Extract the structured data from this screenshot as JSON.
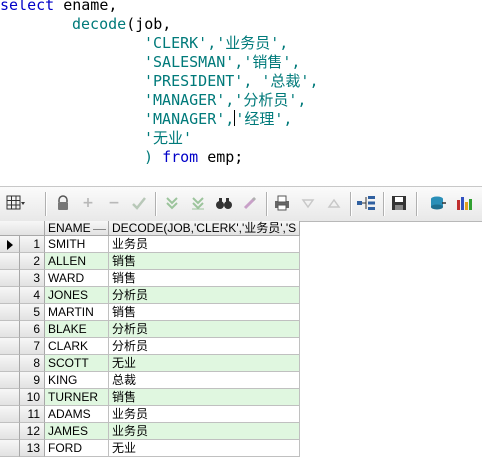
{
  "sql": {
    "line1": {
      "kw": "select",
      "rest": " ename,"
    },
    "line2": {
      "fn": "decode",
      "rest": "(job,"
    },
    "line3": {
      "text": "'CLERK','业务员',"
    },
    "line4": {
      "text": "'SALESMAN','销售',"
    },
    "line5": {
      "text": "'PRESIDENT', '总裁',"
    },
    "line6": {
      "text": "'MANAGER','分析员',"
    },
    "line7a": {
      "text": "'MANAGER',"
    },
    "line7b": {
      "text": "'经理',"
    },
    "line8": {
      "text": "'无业'"
    },
    "line9": {
      "paren": ") ",
      "kw": "from",
      "rest": " emp;"
    }
  },
  "grid": {
    "columns": [
      "ENAME",
      "DECODE(JOB,'CLERK','业务员','S"
    ],
    "rows": [
      {
        "num": "1",
        "ename": "SMITH",
        "decode": "业务员"
      },
      {
        "num": "2",
        "ename": "ALLEN",
        "decode": "销售"
      },
      {
        "num": "3",
        "ename": "WARD",
        "decode": "销售"
      },
      {
        "num": "4",
        "ename": "JONES",
        "decode": "分析员"
      },
      {
        "num": "5",
        "ename": "MARTIN",
        "decode": "销售"
      },
      {
        "num": "6",
        "ename": "BLAKE",
        "decode": "分析员"
      },
      {
        "num": "7",
        "ename": "CLARK",
        "decode": "分析员"
      },
      {
        "num": "8",
        "ename": "SCOTT",
        "decode": "无业"
      },
      {
        "num": "9",
        "ename": "KING",
        "decode": "总裁"
      },
      {
        "num": "10",
        "ename": "TURNER",
        "decode": "销售"
      },
      {
        "num": "11",
        "ename": "ADAMS",
        "decode": "业务员"
      },
      {
        "num": "12",
        "ename": "JAMES",
        "decode": "业务员"
      },
      {
        "num": "13",
        "ename": "FORD",
        "decode": "无业"
      }
    ]
  },
  "colors": {
    "keyword": "#0000c8",
    "function": "#007a7a",
    "string": "#a00000",
    "alt_row": "#e0f7e0"
  },
  "toolbar_icons": [
    "grid-menu-icon",
    "lock-icon",
    "add-row-icon",
    "delete-row-icon",
    "post-icon",
    "filter-icon",
    "clear-filter-icon",
    "find-icon",
    "clear-icon",
    "print-icon",
    "sort-desc-icon",
    "sort-asc-icon",
    "tree-icon",
    "save-icon",
    "export-icon",
    "chart-icon"
  ]
}
